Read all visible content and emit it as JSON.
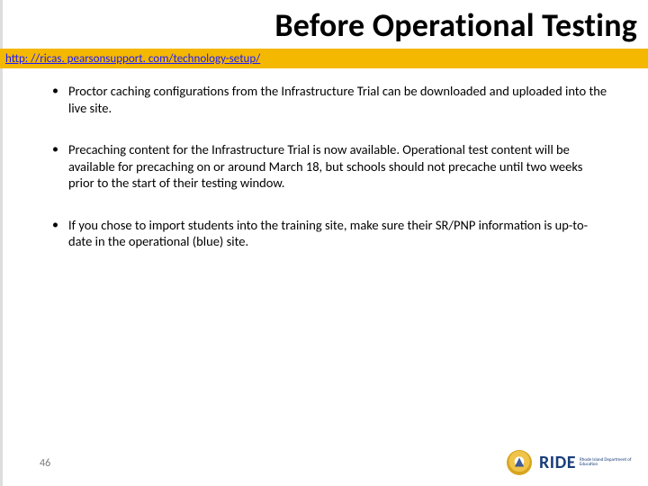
{
  "header": {
    "title": "Before Operational Testing",
    "link_text": "http: //ricas. pearsonsupport. com/technology-setup/",
    "link_href": "http://ricas.pearsonsupport.com/technology-setup/"
  },
  "bullets": [
    "Proctor caching configurations from the Infrastructure Trial can be downloaded and uploaded into the live site.",
    "Precaching content for the Infrastructure Trial is now available. Operational test content will be available for precaching on or around March 18, but schools should not precache until two weeks prior to the start of their testing window.",
    "If you chose to import students into the training site, make sure their SR/PNP information is up-to-date in the operational (blue) site."
  ],
  "footer": {
    "page_number": "46",
    "ride_label": "RIDE",
    "ride_sub": "Rhode Island Department of Education"
  }
}
